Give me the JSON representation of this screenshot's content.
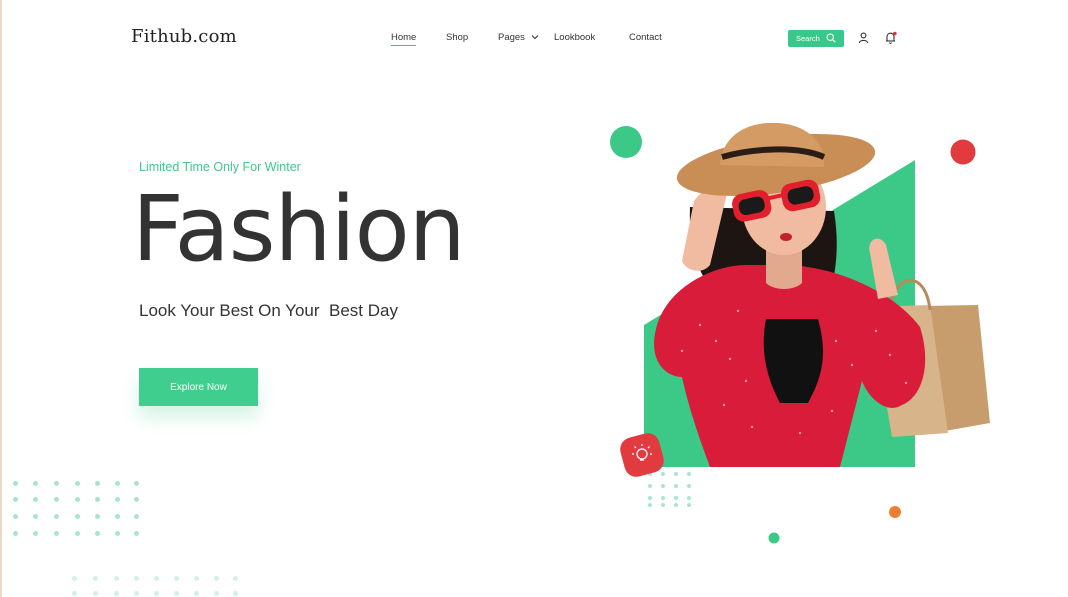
{
  "header": {
    "logo": "Fithub.com",
    "nav": [
      {
        "label": "Home",
        "active": true
      },
      {
        "label": "Shop",
        "active": false
      },
      {
        "label": "Pages",
        "active": false,
        "has_dropdown": true
      },
      {
        "label": "Lookbook",
        "active": false
      },
      {
        "label": "Contact",
        "active": false
      }
    ],
    "search_label": "Search",
    "icons": [
      "search-icon",
      "user-icon",
      "bell-icon"
    ]
  },
  "hero": {
    "tagline": "Limited Time Only For Winter",
    "title": "Fashion",
    "subtitle": "Look Your Best On Your  Best Day",
    "cta_label": "Explore Now"
  },
  "colors": {
    "accent": "#3fce8e",
    "red": "#e3343f",
    "orange": "#ee7e32",
    "text": "#333333"
  }
}
